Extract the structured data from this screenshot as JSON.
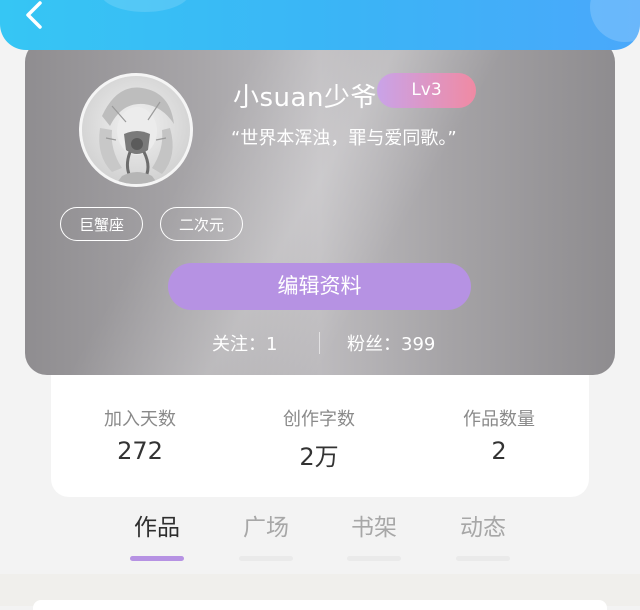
{
  "header": {
    "back_icon": "chevron-left-icon",
    "background_colors": [
      "#36c6f4",
      "#4aa8fb"
    ]
  },
  "profile": {
    "username": "小suan少爷",
    "level": "Lv3",
    "motto": "“世界本浑浊，罪与爱同歌。”",
    "tags": [
      "巨蟹座",
      "二次元"
    ],
    "edit_button": "编辑资料",
    "follows_text": "关注：1",
    "fans_text": "粉丝：399"
  },
  "stats": [
    {
      "label": "加入天数",
      "value": "272"
    },
    {
      "label": "创作字数",
      "value": "2万"
    },
    {
      "label": "作品数量",
      "value": "2"
    }
  ],
  "tabs": [
    {
      "label": "作品",
      "active": true
    },
    {
      "label": "广场",
      "active": false
    },
    {
      "label": "书架",
      "active": false
    },
    {
      "label": "动态",
      "active": false
    }
  ],
  "colors": {
    "accent": "#b692e3",
    "level_badge_start": "#c9a3e8",
    "level_badge_end": "#f08aa3"
  }
}
